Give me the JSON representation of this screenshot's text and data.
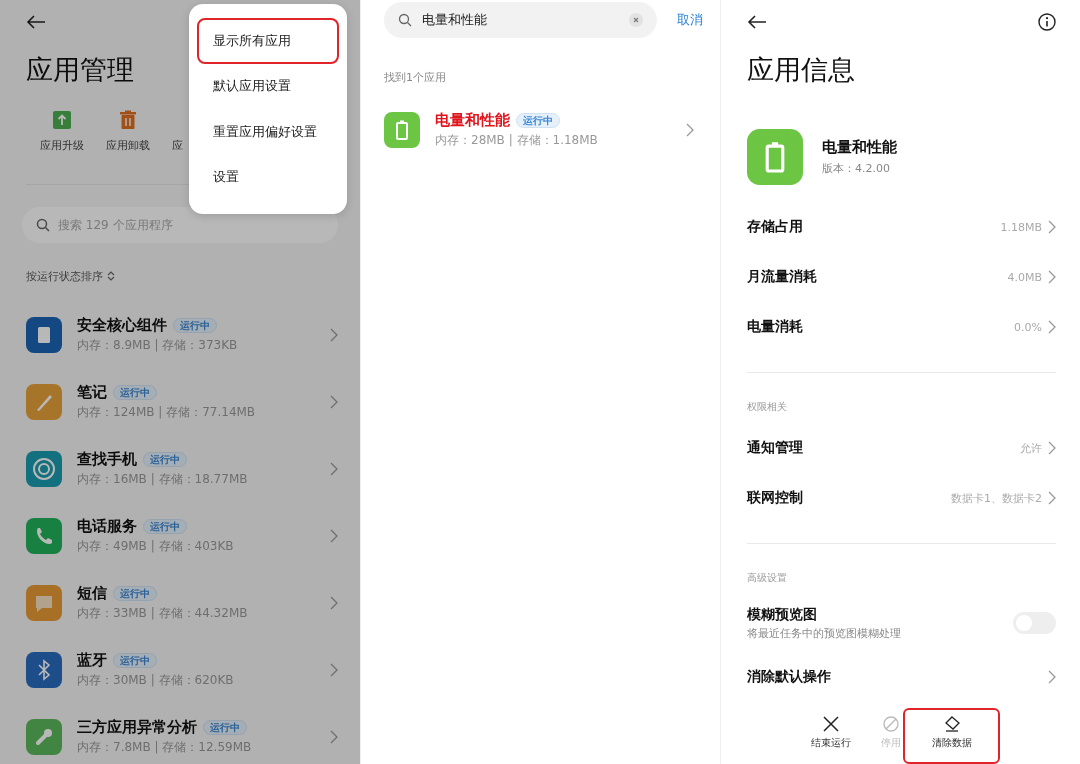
{
  "left": {
    "dimmed": true,
    "title": "应用管理",
    "tools": [
      {
        "label": "应用升级"
      },
      {
        "label": "应用卸载"
      },
      {
        "label": "应"
      }
    ],
    "search": {
      "placeholder": "搜索 129 个应用程序"
    },
    "sort_label": "按运行状态排序",
    "apps": [
      {
        "name": "安全核心组件",
        "status": "运行中",
        "detail": "内存：8.9MB | 存储：373KB"
      },
      {
        "name": "笔记",
        "status": "运行中",
        "detail": "内存：124MB | 存储：77.14MB"
      },
      {
        "name": "查找手机",
        "status": "运行中",
        "detail": "内存：16MB | 存储：18.77MB"
      },
      {
        "name": "电话服务",
        "status": "运行中",
        "detail": "内存：49MB | 存储：403KB"
      },
      {
        "name": "短信",
        "status": "运行中",
        "detail": "内存：33MB | 存储：44.32MB"
      },
      {
        "name": "蓝牙",
        "status": "运行中",
        "detail": "内存：30MB | 存储：620KB"
      },
      {
        "name": "三方应用异常分析",
        "status": "运行中",
        "detail": "内存：7.8MB | 存储：12.59MB"
      }
    ],
    "menu": [
      {
        "label": "显示所有应用",
        "highlighted": true
      },
      {
        "label": "默认应用设置",
        "highlighted": false
      },
      {
        "label": "重置应用偏好设置",
        "highlighted": false
      },
      {
        "label": "设置",
        "highlighted": false
      }
    ]
  },
  "middle": {
    "search": {
      "value": "电量和性能"
    },
    "cancel": "取消",
    "result_count": "找到1个应用",
    "results": [
      {
        "name": "电量和性能",
        "status": "运行中",
        "detail": "内存：28MB | 存储：1.18MB"
      }
    ]
  },
  "right": {
    "title": "应用信息",
    "app": {
      "name": "电量和性能",
      "version": "版本：4.2.00"
    },
    "sections": [
      {
        "rows": [
          {
            "kind": "link",
            "label": "存储占用",
            "value": "1.18MB"
          },
          {
            "kind": "link",
            "label": "月流量消耗",
            "value": "4.0MB"
          },
          {
            "kind": "link",
            "label": "电量消耗",
            "value": "0.0%"
          }
        ]
      },
      {
        "header": "权限相关",
        "rows": [
          {
            "kind": "link",
            "label": "通知管理",
            "value": "允许"
          },
          {
            "kind": "link",
            "label": "联网控制",
            "value": "数据卡1、数据卡2"
          }
        ]
      },
      {
        "header": "高级设置",
        "rows": [
          {
            "kind": "toggle",
            "label": "模糊预览图",
            "subtitle": "将最近任务中的预览图模糊处理",
            "on": false
          },
          {
            "kind": "link",
            "label": "消除默认操作"
          }
        ]
      }
    ],
    "actions": [
      {
        "label": "结束运行",
        "disabled": false,
        "highlighted": false
      },
      {
        "label": "停用",
        "disabled": true,
        "highlighted": false
      },
      {
        "label": "清除数据",
        "disabled": false,
        "highlighted": true
      }
    ]
  }
}
